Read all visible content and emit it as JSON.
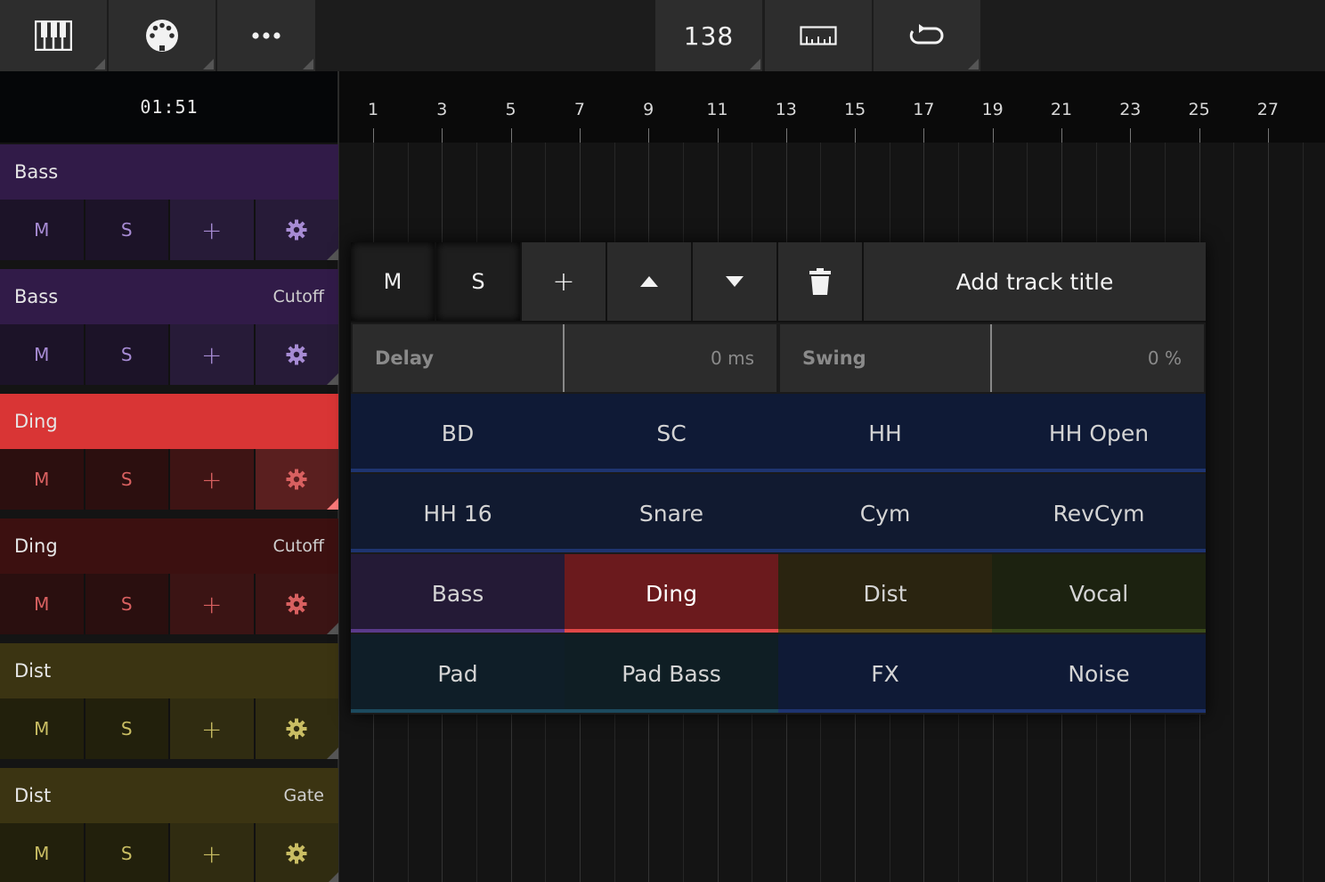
{
  "toolbar": {
    "keyboard_icon": "piano-keys-icon",
    "midi_icon": "midi-connector-icon",
    "more_icon": "ellipsis-icon",
    "tempo": "138",
    "ruler_icon": "ruler-icon",
    "loop_icon": "loop-icon"
  },
  "time": "01:51",
  "ruler": {
    "bars": [
      "1",
      "3",
      "5",
      "7",
      "9",
      "11",
      "13",
      "15",
      "17",
      "19",
      "21",
      "23",
      "25",
      "27"
    ]
  },
  "tracks": [
    {
      "name": "Bass",
      "param": "",
      "head": "#311b48",
      "ctrl": "#1c1328",
      "ctrl_plus": "#271b38",
      "ctrl_fg": "#a78bd4"
    },
    {
      "name": "Bass",
      "param": "Cutoff",
      "head": "#311b48",
      "ctrl": "#1c1328",
      "ctrl_plus": "#271b38",
      "ctrl_fg": "#a78bd4"
    },
    {
      "name": "Ding",
      "param": "",
      "head": "#d93535",
      "ctrl": "#2c0f0f",
      "ctrl_plus": "#3e1414",
      "ctrl_fg": "#d86060"
    },
    {
      "name": "Ding",
      "param": "Cutoff",
      "head": "#3c1010",
      "ctrl": "#2a0f0f",
      "ctrl_plus": "#3b1414",
      "ctrl_fg": "#d86060"
    },
    {
      "name": "Dist",
      "param": "",
      "head": "#3b3412",
      "ctrl": "#22200c",
      "ctrl_plus": "#302c11",
      "ctrl_fg": "#c9bd63"
    },
    {
      "name": "Dist",
      "param": "Gate",
      "head": "#3b3412",
      "ctrl": "#22200c",
      "ctrl_plus": "#302c11",
      "ctrl_fg": "#c9bd63"
    }
  ],
  "track_buttons": {
    "mute": "M",
    "solo": "S",
    "add": "+",
    "settings_icon": "gear-icon"
  },
  "popup": {
    "mute": "M",
    "solo": "S",
    "add": "+",
    "up_icon": "triangle-up-icon",
    "down_icon": "triangle-down-icon",
    "delete_icon": "trash-icon",
    "title_placeholder": "Add track title",
    "delay_label": "Delay",
    "delay_value": "0 ms",
    "swing_label": "Swing",
    "swing_value": "0 %",
    "pads": [
      {
        "label": "BD",
        "bg": "#0f1a36",
        "bar": "#1e3470"
      },
      {
        "label": "SC",
        "bg": "#0f1a36",
        "bar": "#1e3470"
      },
      {
        "label": "HH",
        "bg": "#0f1a36",
        "bar": "#1e3470"
      },
      {
        "label": "HH Open",
        "bg": "#0f1a36",
        "bar": "#1e3470"
      },
      {
        "label": "HH 16",
        "bg": "#111a30",
        "bar": "#1e3470"
      },
      {
        "label": "Snare",
        "bg": "#111a30",
        "bar": "#1e3470"
      },
      {
        "label": "Cym",
        "bg": "#111a30",
        "bar": "#1e3470"
      },
      {
        "label": "RevCym",
        "bg": "#111a30",
        "bar": "#1e3470"
      },
      {
        "label": "Bass",
        "bg": "#241a36",
        "bar": "#5a3a8a"
      },
      {
        "label": "Ding",
        "bg": "#6b1a1d",
        "bar": "#e04848",
        "active": true
      },
      {
        "label": "Dist",
        "bg": "#2a2410",
        "bar": "#5a4d18"
      },
      {
        "label": "Vocal",
        "bg": "#1c2210",
        "bar": "#3a4a1a"
      },
      {
        "label": "Pad",
        "bg": "#0f1e28",
        "bar": "#1c4a5e"
      },
      {
        "label": "Pad Bass",
        "bg": "#0f1e24",
        "bar": "#1c4a5e"
      },
      {
        "label": "FX",
        "bg": "#0f1a36",
        "bar": "#1e3470"
      },
      {
        "label": "Noise",
        "bg": "#0f1a36",
        "bar": "#1e3470"
      }
    ]
  }
}
